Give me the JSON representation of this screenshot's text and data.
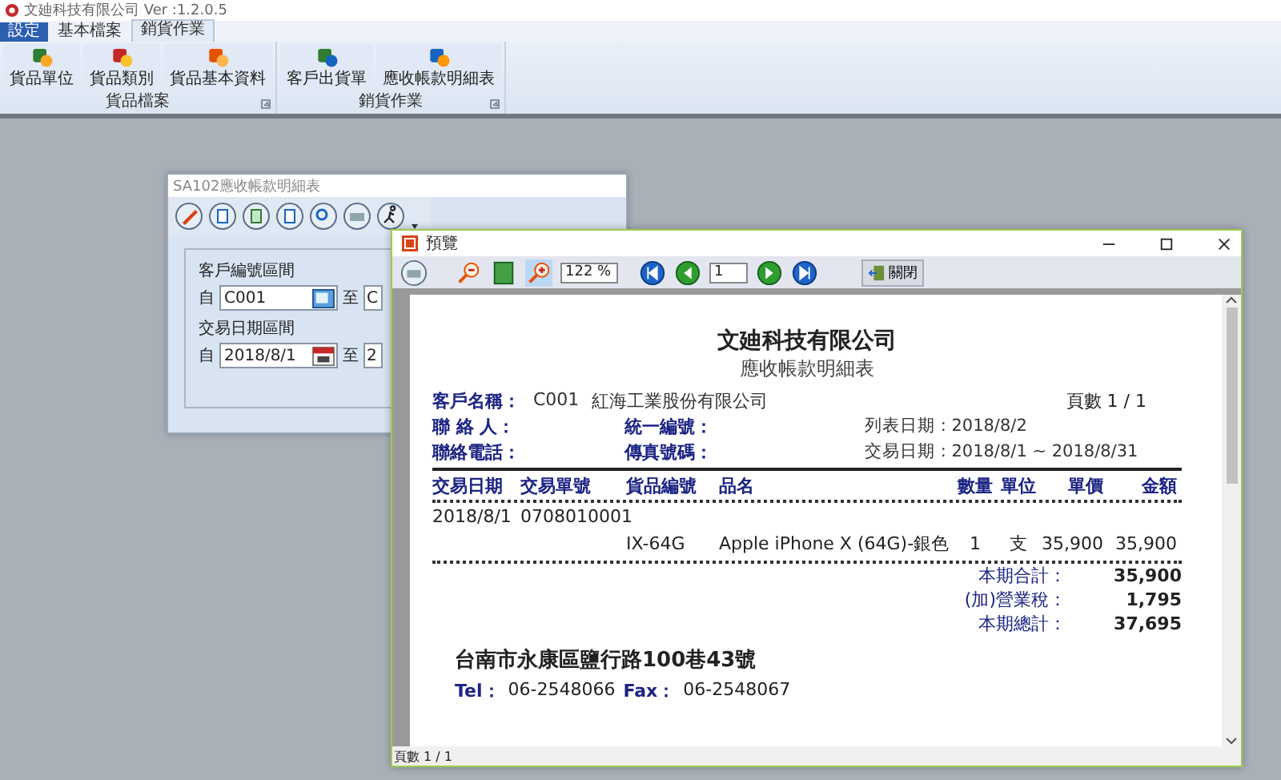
{
  "app": {
    "title": "文廸科技有限公司 Ver :1.2.0.5"
  },
  "tabs": [
    {
      "label": "設定",
      "selected": false,
      "kind": "file"
    },
    {
      "label": "基本檔案",
      "selected": false,
      "kind": "tab"
    },
    {
      "label": "銷貨作業",
      "selected": true,
      "kind": "tab"
    }
  ],
  "ribbon_groups": [
    {
      "label": "貨品檔案",
      "buttons": [
        "貨品單位",
        "貨品類別",
        "貨品基本資料"
      ]
    },
    {
      "label": "銷貨作業",
      "buttons": [
        "客戶出貨單",
        "應收帳款明細表"
      ]
    }
  ],
  "dialog": {
    "title": "SA102應收帳款明細表",
    "ranges": [
      {
        "label": "客戶編號區間",
        "from_label": "自",
        "from_value": "C001",
        "to_label": "至",
        "to_value": "C",
        "kind": "lookup"
      },
      {
        "label": "交易日期區間",
        "from_label": "自",
        "from_value": "2018/8/1",
        "to_label": "至",
        "to_value": "2",
        "kind": "date"
      }
    ]
  },
  "preview": {
    "title": "預覽",
    "zoom": "122 %",
    "page_number": "1",
    "close_button": "關閉",
    "status": "頁數 1 / 1",
    "report": {
      "company": "文廸科技有限公司",
      "title": "應收帳款明細表",
      "customer": {
        "label": "客戶名稱：",
        "code": "C001",
        "name": "紅海工業股份有限公司"
      },
      "page_count": "頁數 1 / 1",
      "info_rows": [
        {
          "left": "聯 絡 人：",
          "middle": "統一編號：",
          "right": "列表日期 : 2018/8/2"
        },
        {
          "left": "聯絡電話：",
          "middle": "傳真號碼：",
          "right": "交易日期 : 2018/8/1 ~ 2018/8/31"
        }
      ],
      "columns": [
        "交易日期",
        "交易單號",
        "貨品編號",
        "品名",
        "數量",
        "單位",
        "單價",
        "金額"
      ],
      "rows": [
        {
          "date": "2018/8/1",
          "number": "0708010001",
          "items": [
            {
              "code": "IX-64G",
              "name": "Apple iPhone X (64G)-銀色",
              "qty": "1",
              "unit": "支",
              "price": "35,900",
              "amount": "35,900"
            }
          ]
        }
      ],
      "totals": [
        {
          "label": "本期合計：",
          "value": "35,900"
        },
        {
          "label": "(加)營業稅：",
          "value": "1,795"
        },
        {
          "label": "本期總計：",
          "value": "37,695"
        }
      ],
      "address": "台南市永康區鹽行路100巷43號",
      "contacts": [
        {
          "label": "Tel：",
          "value": "06-2548066"
        },
        {
          "label": "Fax：",
          "value": "06-2548067"
        }
      ]
    }
  }
}
